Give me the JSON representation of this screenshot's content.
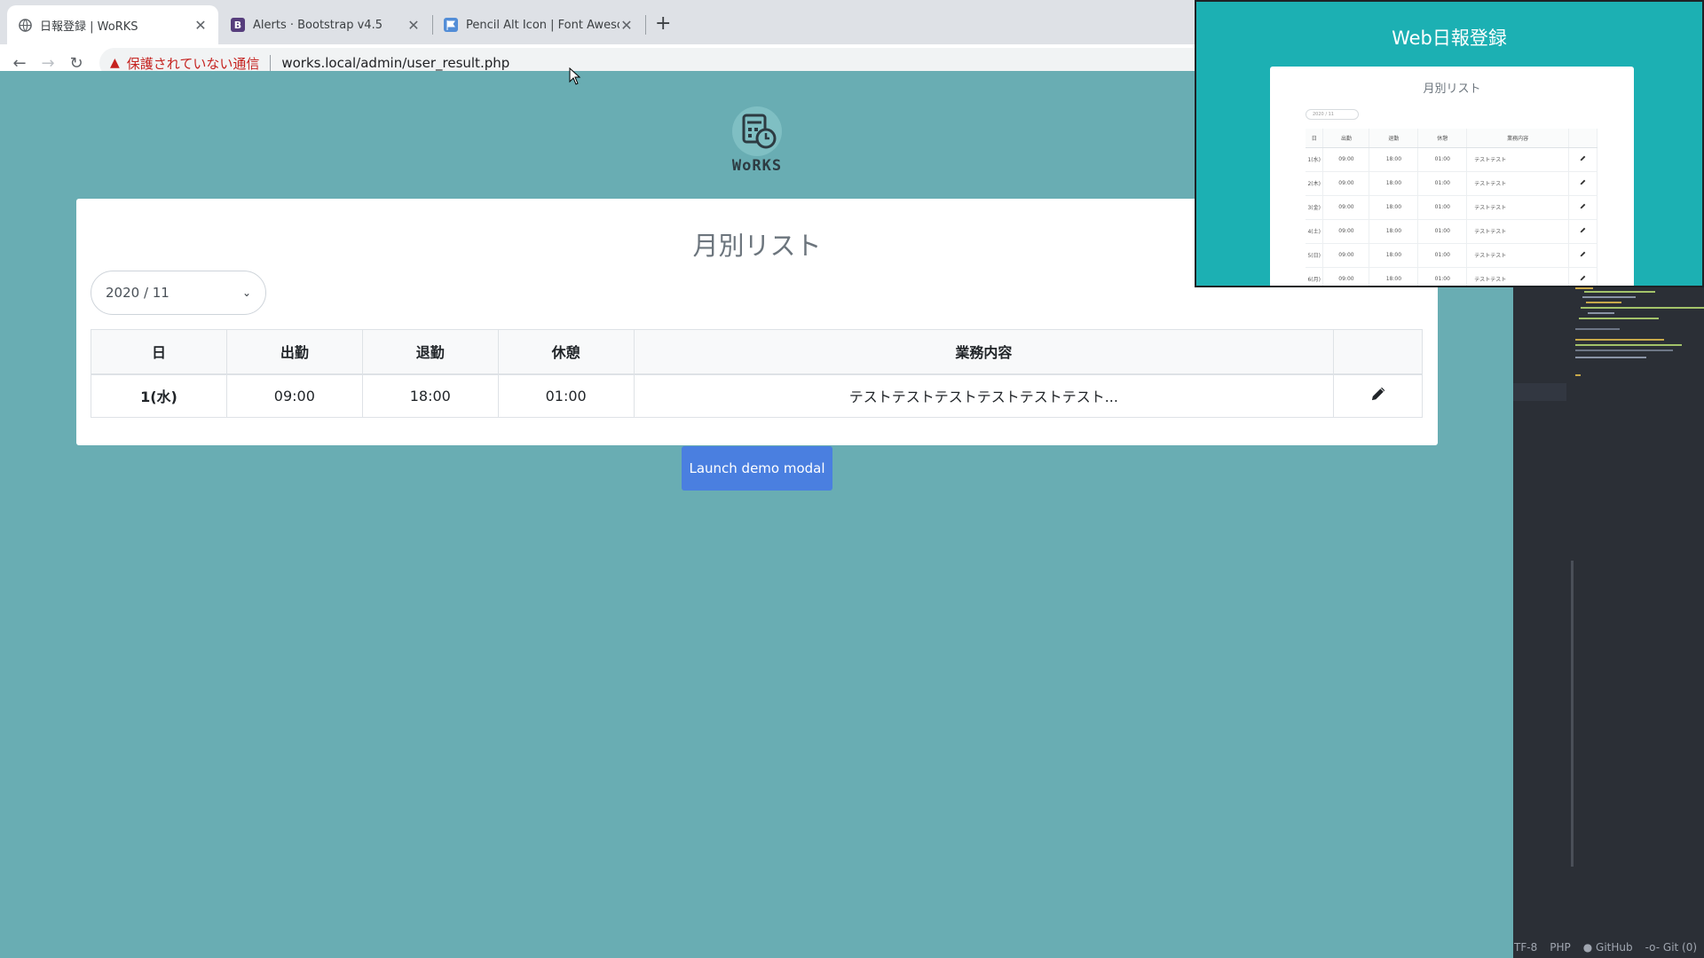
{
  "browser": {
    "tabs": [
      {
        "label": "日報登録 | WoRKS",
        "favicon": "globe-icon",
        "active": true
      },
      {
        "label": "Alerts · Bootstrap v4.5",
        "favicon": "B",
        "active": false
      },
      {
        "label": "Pencil Alt Icon | Font Awesome",
        "favicon": "flag-icon",
        "active": false
      }
    ],
    "security_label": "保護されていない通信",
    "url": "works.local/admin/user_result.php"
  },
  "page": {
    "logo_text": "WoRKS",
    "card_title": "月別リスト",
    "month_select_value": "2020 / 11",
    "table_headers": [
      "日",
      "出勤",
      "退勤",
      "休憩",
      "業務内容",
      ""
    ],
    "rows": [
      {
        "day": "1(水)",
        "in": "09:00",
        "out": "18:00",
        "break": "01:00",
        "work": "テストテストテストテストテストテスト..."
      }
    ],
    "modal_button_label": "Launch demo modal"
  },
  "pip": {
    "title": "Web日報登録",
    "card_title": "月別リスト",
    "select_value": "2020 / 11",
    "headers": [
      "日",
      "出勤",
      "退勤",
      "休憩",
      "業務内容",
      ""
    ],
    "rows": [
      {
        "day": "1(水)",
        "in": "09:00",
        "out": "18:00",
        "break": "01:00",
        "work": "テストテスト"
      },
      {
        "day": "2(木)",
        "in": "09:00",
        "out": "18:00",
        "break": "01:00",
        "work": "テストテスト"
      },
      {
        "day": "3(金)",
        "in": "09:00",
        "out": "18:00",
        "break": "01:00",
        "work": "テストテスト"
      },
      {
        "day": "4(土)",
        "in": "09:00",
        "out": "18:00",
        "break": "01:00",
        "work": "テストテスト"
      },
      {
        "day": "5(日)",
        "in": "09:00",
        "out": "18:00",
        "break": "01:00",
        "work": "テストテスト"
      },
      {
        "day": "6(月)",
        "in": "09:00",
        "out": "18:00",
        "break": "01:00",
        "work": "テストテスト"
      }
    ]
  },
  "editor": {
    "status": [
      "TF-8",
      "PHP",
      "GitHub",
      "Git (0)"
    ]
  },
  "colors": {
    "page_bg": "#69adb3",
    "pip_bg": "#1cb0b3",
    "button": "#4a7fe0",
    "warning": "#c5221f"
  }
}
